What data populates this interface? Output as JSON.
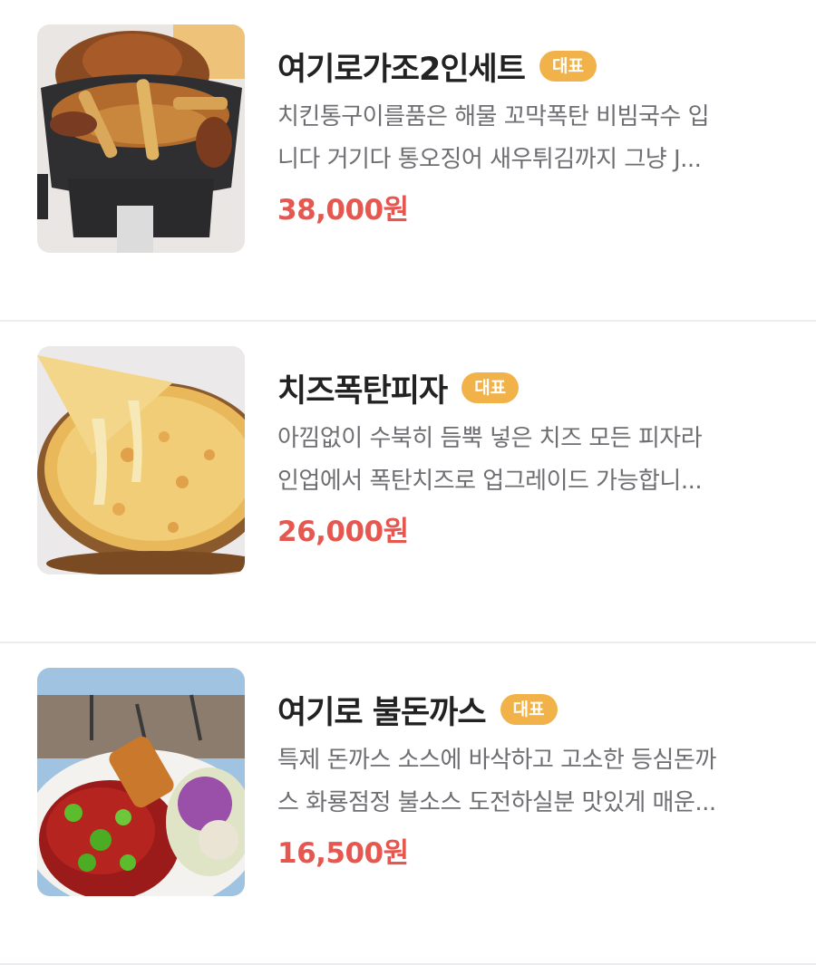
{
  "menu": {
    "items": [
      {
        "name": "여기로가조2인세트",
        "badge": "대표",
        "description_lines": [
          "치킨통구이를품은 해물 꼬막폭탄 비빔국수 입",
          "니다 거기다 통오징어 새우튀김까지 그냥 J..."
        ],
        "price": "38,000원",
        "photo_icon": "chicken-seafood-pot-photo"
      },
      {
        "name": "치즈폭탄피자",
        "badge": "대표",
        "description_lines": [
          "아낌없이 수북히 듬뿍 넣은 치즈 모든 피자라",
          "인업에서 폭탄치즈로 업그레이드 가능합니..."
        ],
        "price": "26,000원",
        "photo_icon": "cheese-pizza-photo"
      },
      {
        "name": "여기로 불돈까스",
        "badge": "대표",
        "description_lines": [
          "특제 돈까스 소스에 바삭하고 고소한 등심돈까",
          "스 화룡점정 불소스 도전하실분 맛있게 매운..."
        ],
        "price": "16,500원",
        "photo_icon": "fire-pork-cutlet-photo"
      }
    ]
  },
  "colors": {
    "badge": "#f2b24a",
    "price": "#e5574f",
    "title": "#222222",
    "description": "#6e6e73",
    "divider": "#ececee"
  }
}
